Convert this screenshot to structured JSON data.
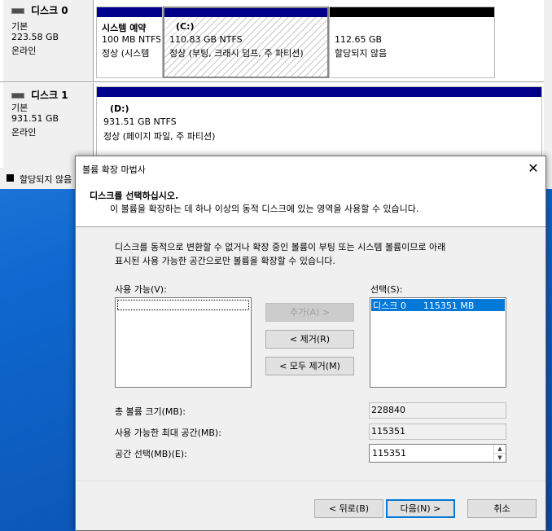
{
  "disk_management": {
    "disks": [
      {
        "name": "디스크 0",
        "type": "기본",
        "size": "223.58 GB",
        "status": "온라인",
        "partitions": [
          {
            "name": "시스템 예약",
            "size": "100 MB NTFS",
            "status": "정상 (시스템"
          },
          {
            "name": "(C:)",
            "size": "110.83 GB NTFS",
            "status": "정상 (부팅, 크래시 덤프, 주 파티션)"
          },
          {
            "name": "",
            "size": "112.65 GB",
            "status": "할당되지 않음"
          }
        ]
      },
      {
        "name": "디스크 1",
        "type": "기본",
        "size": "931.51 GB",
        "status": "온라인",
        "partitions": [
          {
            "name": "(D:)",
            "size": "931.51 GB NTFS",
            "status": "정상 (페이지 파일, 주 파티션)"
          }
        ]
      }
    ],
    "legend_unallocated": "할당되지 않음",
    "colors": {
      "primary_bar": "#00008b",
      "unallocated_bar": "#000000"
    }
  },
  "dialog": {
    "title": "볼륨 확장 마법사",
    "close_symbol": "✕",
    "header_title": "디스크를 선택하십시오.",
    "header_subtitle": "이 볼륨을 확장하는 데 하나 이상의 동적 디스크에 있는 영역을 사용할 수 있습니다.",
    "description_line1": "디스크를 동적으로 변환할 수 없거나 확장 중인 볼륨이 부팅 또는 시스템 볼륨이므로 아래",
    "description_line2": "표시된 사용 가능한 공간으로만 볼륨을 확장할 수 있습니다.",
    "available_label": "사용 가능(V):",
    "available_items": [],
    "selected_label": "선택(S):",
    "selected_items": [
      {
        "disk": "디스크 0",
        "size": "115351 MB"
      }
    ],
    "add_button": "추가(A) >",
    "remove_button": "< 제거(R)",
    "remove_all_button": "< 모두 제거(M)",
    "total_size_label": "총 볼륨 크기(MB):",
    "total_size_value": "228840",
    "max_space_label": "사용 가능한 최대 공간(MB):",
    "max_space_value": "115351",
    "select_space_label": "공간 선택(MB)(E):",
    "select_space_value": "115351",
    "back_button": "< 뒤로(B)",
    "next_button": "다음(N) >",
    "cancel_button": "취소",
    "accent_color": "#0078d7"
  }
}
